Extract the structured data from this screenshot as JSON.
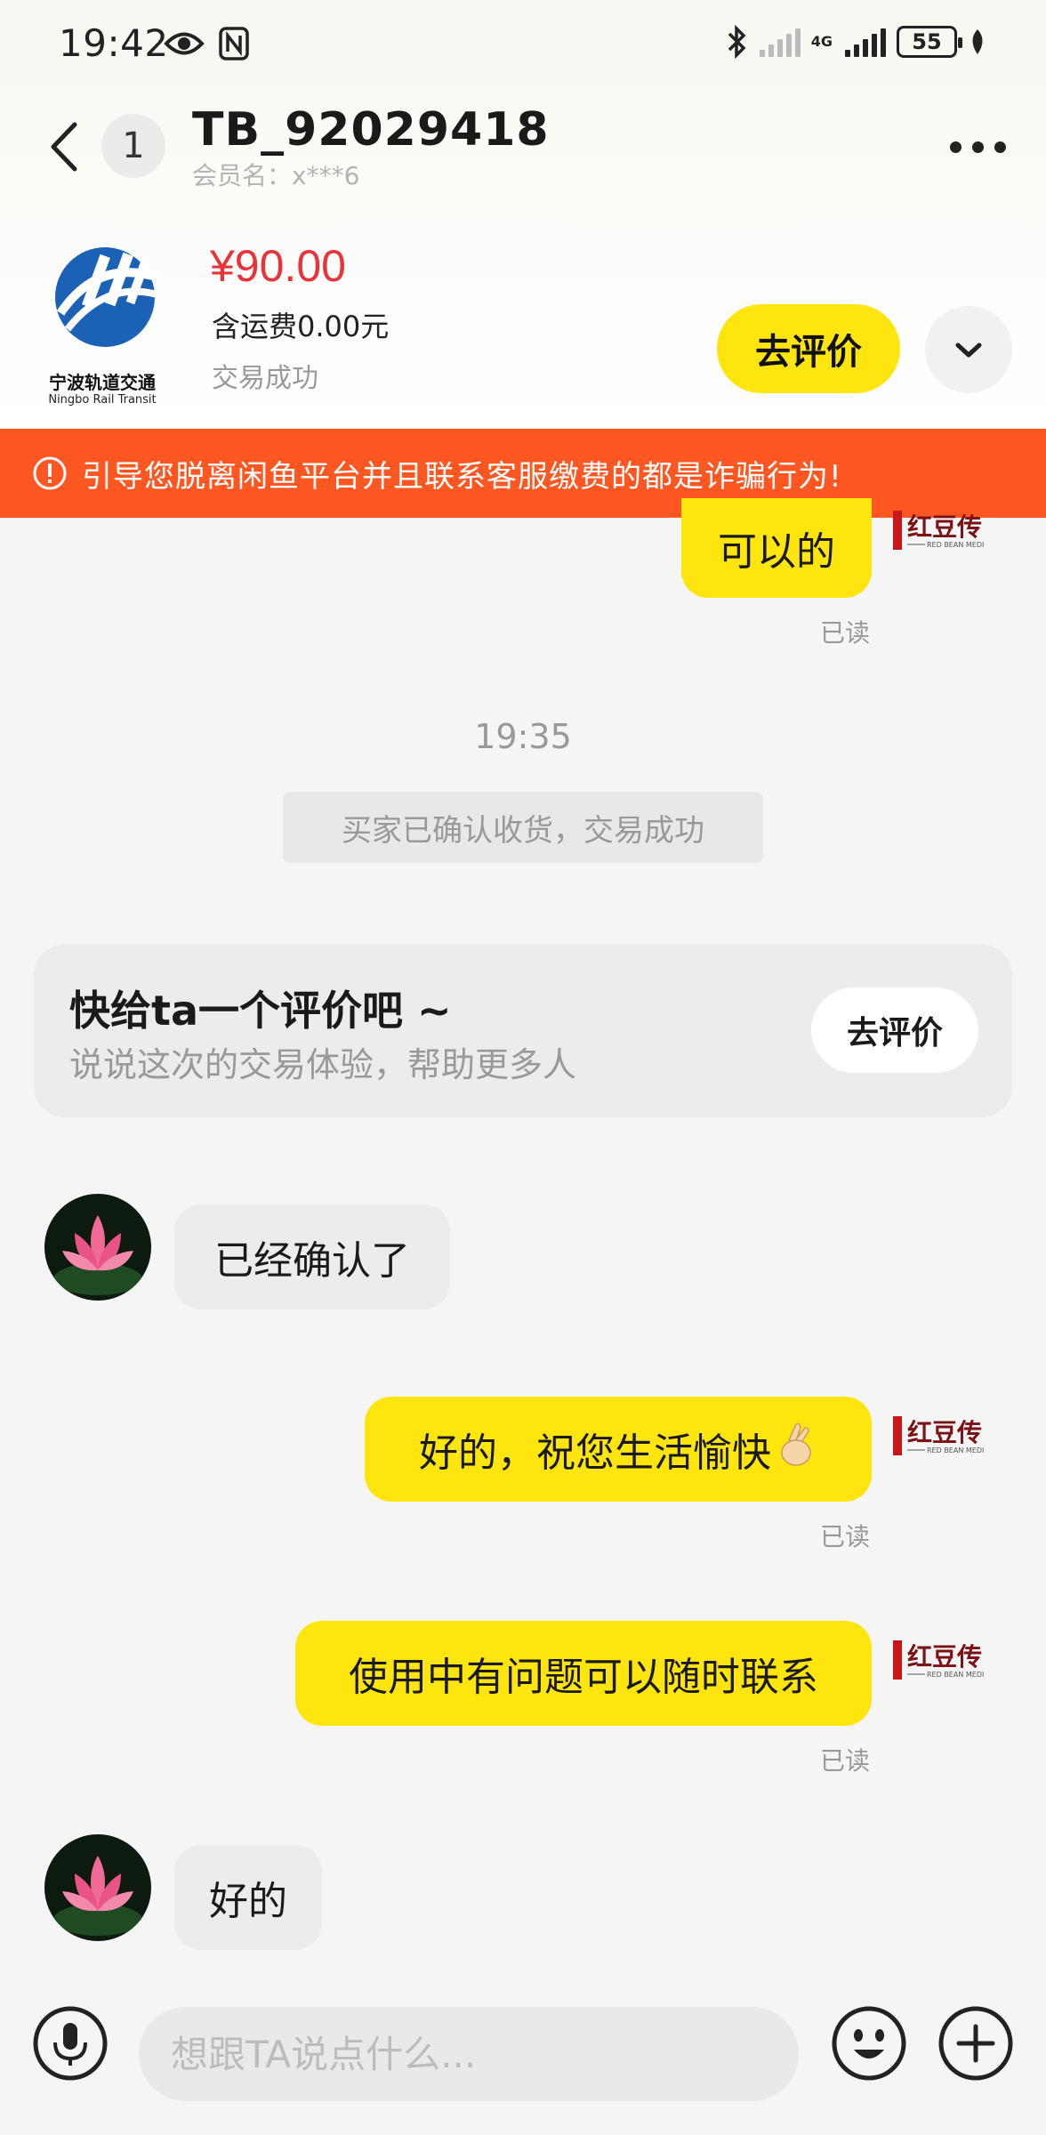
{
  "status_bar": {
    "time": "19:42",
    "network_label": "4G",
    "battery": "55"
  },
  "header": {
    "unread_count": "1",
    "title": "TB_92029418",
    "member_name": "会员名：x***6"
  },
  "product": {
    "logo_cn": "宁波轨道交通",
    "logo_en": "Ningbo Rail Transit",
    "price": "¥90.00",
    "shipping": "含运费0.00元",
    "status": "交易成功",
    "review_button": "去评价"
  },
  "warning": {
    "text": "引导您脱离闲鱼平台并且联系客服缴费的都是诈骗行为!"
  },
  "messages": {
    "msg1": {
      "text": "可以的",
      "read": "已读"
    },
    "time_separator": "19:35",
    "system_message": "买家已确认收货，交易成功",
    "review_card": {
      "title": "快给ta一个评价吧 ~",
      "subtitle": "说说这次的交易体验，帮助更多人",
      "button": "去评价"
    },
    "msg2": {
      "text": "已经确认了"
    },
    "msg3": {
      "text": "好的，祝您生活愉快",
      "read": "已读"
    },
    "msg4": {
      "text": "使用中有问题可以随时联系",
      "read": "已读"
    },
    "msg5": {
      "text": "好的"
    }
  },
  "my_avatar": {
    "text": "红豆传",
    "sub": "RED BEAN MEDI"
  },
  "input": {
    "placeholder": "想跟TA说点什么..."
  }
}
